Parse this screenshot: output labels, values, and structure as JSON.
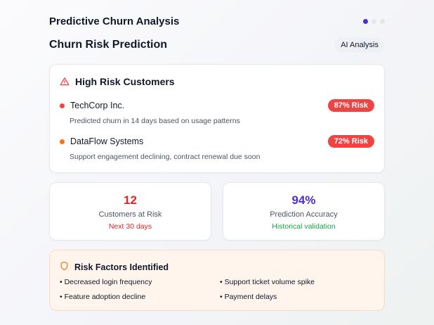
{
  "app": {
    "title": "Predictive Churn Analysis"
  },
  "pager": {
    "count": 3,
    "active_index": 0,
    "active_color": "#4f2bd6"
  },
  "section": {
    "title": "Churn Risk Prediction",
    "badge": "AI Analysis"
  },
  "high_risk": {
    "title": "High Risk Customers",
    "icon": "warning-triangle-icon",
    "customers": [
      {
        "name": "TechCorp Inc.",
        "risk": "87% Risk",
        "note": "Predicted churn in 14 days based on usage patterns",
        "dot_color": "#ef4444"
      },
      {
        "name": "DataFlow Systems",
        "risk": "72% Risk",
        "note": "Support engagement declining, contract renewal due soon",
        "dot_color": "#f97316"
      }
    ]
  },
  "stats": [
    {
      "value": "12",
      "label": "Customers at Risk",
      "sub": "Next 30 days",
      "value_color": "#dc2626",
      "sub_color": "#dc2626"
    },
    {
      "value": "94%",
      "label": "Prediction Accuracy",
      "sub": "Historical validation",
      "value_color": "#4f2bd6",
      "sub_color": "#16a34a"
    }
  ],
  "risk_factors": {
    "title": "Risk Factors Identified",
    "icon": "shield-icon",
    "items": [
      "• Decreased login frequency",
      "• Support ticket volume spike",
      "• Feature adoption decline",
      "• Payment delays"
    ]
  }
}
